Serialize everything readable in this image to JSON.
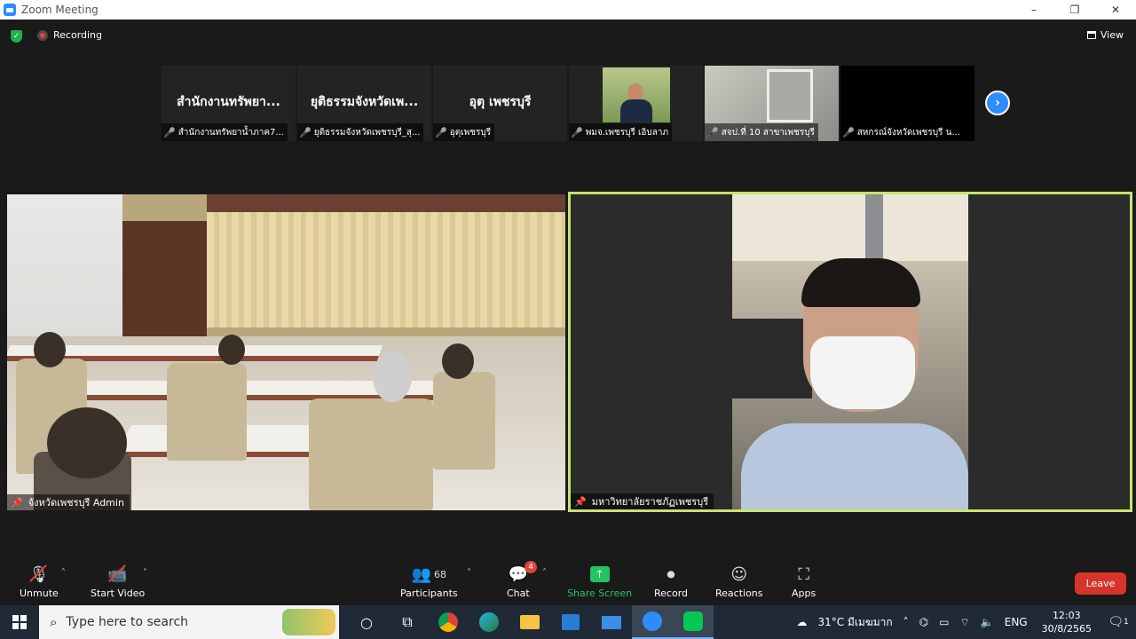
{
  "window": {
    "title": "Zoom Meeting",
    "controls": [
      "–",
      "❐",
      "✕"
    ]
  },
  "topbar": {
    "recording_label": "Recording",
    "view_label": "View"
  },
  "thumbnails": [
    {
      "big_name": "สำนักงานทรัพยา...",
      "label": "สำนักงานทรัพยาน้ำภาค7..."
    },
    {
      "big_name": "ยุติธรรมจังหวัดเพ...",
      "label": "ยุติธรรมจังหวัดเพชรบุรี_สุ..."
    },
    {
      "big_name": "อุตุ เพชรบุรี",
      "label": "อุตุเพชรบุรี"
    },
    {
      "big_name": "",
      "label": "พมจ.เพชรบุรี เอิบลาภ"
    },
    {
      "big_name": "",
      "label": "สจป.ที่ 10 สาขาเพชรบุรี"
    },
    {
      "big_name": "",
      "label": "สหกรณ์จังหวัดเพชรบุรี น..."
    }
  ],
  "videos": {
    "left_label": "จังหวัดเพชรบุรี Admin",
    "right_label": "มหาวิทยาลัยราชภัฏเพชรบุรี"
  },
  "toolbar": {
    "unmute": "Unmute",
    "start_video": "Start Video",
    "participants": "Participants",
    "participants_count": "68",
    "chat": "Chat",
    "chat_badge": "4",
    "share_screen": "Share Screen",
    "record": "Record",
    "reactions": "Reactions",
    "apps": "Apps",
    "leave": "Leave"
  },
  "taskbar": {
    "search_placeholder": "Type here to search",
    "weather": "31°C  มีเมฆมาก",
    "language": "ENG",
    "time": "12:03",
    "date": "30/8/2565",
    "notification_count": "1"
  },
  "colors": {
    "accent": "#2d8cff",
    "active_speaker_border": "#c6e36b",
    "leave": "#d9342b",
    "share": "#22c55e"
  }
}
